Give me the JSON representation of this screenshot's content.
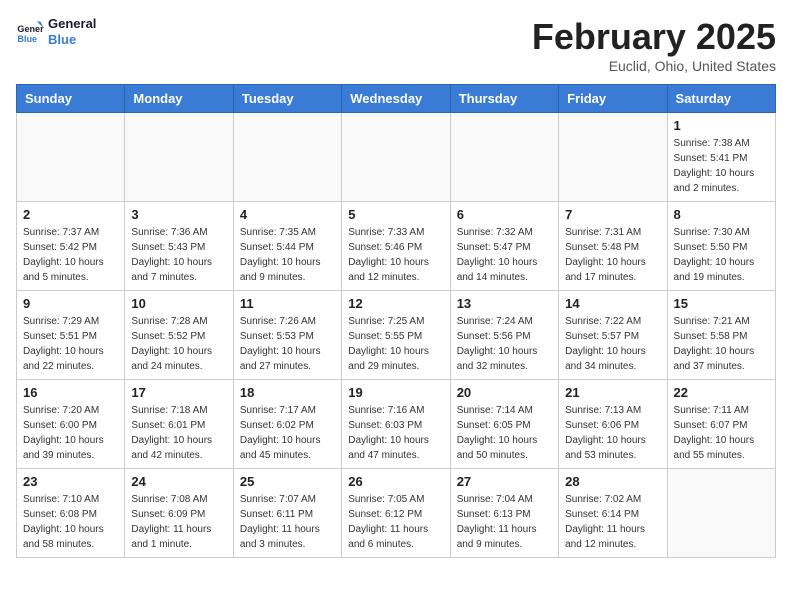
{
  "header": {
    "logo_general": "General",
    "logo_blue": "Blue",
    "title": "February 2025",
    "subtitle": "Euclid, Ohio, United States"
  },
  "days_of_week": [
    "Sunday",
    "Monday",
    "Tuesday",
    "Wednesday",
    "Thursday",
    "Friday",
    "Saturday"
  ],
  "weeks": [
    [
      {
        "day": "",
        "info": ""
      },
      {
        "day": "",
        "info": ""
      },
      {
        "day": "",
        "info": ""
      },
      {
        "day": "",
        "info": ""
      },
      {
        "day": "",
        "info": ""
      },
      {
        "day": "",
        "info": ""
      },
      {
        "day": "1",
        "info": "Sunrise: 7:38 AM\nSunset: 5:41 PM\nDaylight: 10 hours\nand 2 minutes."
      }
    ],
    [
      {
        "day": "2",
        "info": "Sunrise: 7:37 AM\nSunset: 5:42 PM\nDaylight: 10 hours\nand 5 minutes."
      },
      {
        "day": "3",
        "info": "Sunrise: 7:36 AM\nSunset: 5:43 PM\nDaylight: 10 hours\nand 7 minutes."
      },
      {
        "day": "4",
        "info": "Sunrise: 7:35 AM\nSunset: 5:44 PM\nDaylight: 10 hours\nand 9 minutes."
      },
      {
        "day": "5",
        "info": "Sunrise: 7:33 AM\nSunset: 5:46 PM\nDaylight: 10 hours\nand 12 minutes."
      },
      {
        "day": "6",
        "info": "Sunrise: 7:32 AM\nSunset: 5:47 PM\nDaylight: 10 hours\nand 14 minutes."
      },
      {
        "day": "7",
        "info": "Sunrise: 7:31 AM\nSunset: 5:48 PM\nDaylight: 10 hours\nand 17 minutes."
      },
      {
        "day": "8",
        "info": "Sunrise: 7:30 AM\nSunset: 5:50 PM\nDaylight: 10 hours\nand 19 minutes."
      }
    ],
    [
      {
        "day": "9",
        "info": "Sunrise: 7:29 AM\nSunset: 5:51 PM\nDaylight: 10 hours\nand 22 minutes."
      },
      {
        "day": "10",
        "info": "Sunrise: 7:28 AM\nSunset: 5:52 PM\nDaylight: 10 hours\nand 24 minutes."
      },
      {
        "day": "11",
        "info": "Sunrise: 7:26 AM\nSunset: 5:53 PM\nDaylight: 10 hours\nand 27 minutes."
      },
      {
        "day": "12",
        "info": "Sunrise: 7:25 AM\nSunset: 5:55 PM\nDaylight: 10 hours\nand 29 minutes."
      },
      {
        "day": "13",
        "info": "Sunrise: 7:24 AM\nSunset: 5:56 PM\nDaylight: 10 hours\nand 32 minutes."
      },
      {
        "day": "14",
        "info": "Sunrise: 7:22 AM\nSunset: 5:57 PM\nDaylight: 10 hours\nand 34 minutes."
      },
      {
        "day": "15",
        "info": "Sunrise: 7:21 AM\nSunset: 5:58 PM\nDaylight: 10 hours\nand 37 minutes."
      }
    ],
    [
      {
        "day": "16",
        "info": "Sunrise: 7:20 AM\nSunset: 6:00 PM\nDaylight: 10 hours\nand 39 minutes."
      },
      {
        "day": "17",
        "info": "Sunrise: 7:18 AM\nSunset: 6:01 PM\nDaylight: 10 hours\nand 42 minutes."
      },
      {
        "day": "18",
        "info": "Sunrise: 7:17 AM\nSunset: 6:02 PM\nDaylight: 10 hours\nand 45 minutes."
      },
      {
        "day": "19",
        "info": "Sunrise: 7:16 AM\nSunset: 6:03 PM\nDaylight: 10 hours\nand 47 minutes."
      },
      {
        "day": "20",
        "info": "Sunrise: 7:14 AM\nSunset: 6:05 PM\nDaylight: 10 hours\nand 50 minutes."
      },
      {
        "day": "21",
        "info": "Sunrise: 7:13 AM\nSunset: 6:06 PM\nDaylight: 10 hours\nand 53 minutes."
      },
      {
        "day": "22",
        "info": "Sunrise: 7:11 AM\nSunset: 6:07 PM\nDaylight: 10 hours\nand 55 minutes."
      }
    ],
    [
      {
        "day": "23",
        "info": "Sunrise: 7:10 AM\nSunset: 6:08 PM\nDaylight: 10 hours\nand 58 minutes."
      },
      {
        "day": "24",
        "info": "Sunrise: 7:08 AM\nSunset: 6:09 PM\nDaylight: 11 hours\nand 1 minute."
      },
      {
        "day": "25",
        "info": "Sunrise: 7:07 AM\nSunset: 6:11 PM\nDaylight: 11 hours\nand 3 minutes."
      },
      {
        "day": "26",
        "info": "Sunrise: 7:05 AM\nSunset: 6:12 PM\nDaylight: 11 hours\nand 6 minutes."
      },
      {
        "day": "27",
        "info": "Sunrise: 7:04 AM\nSunset: 6:13 PM\nDaylight: 11 hours\nand 9 minutes."
      },
      {
        "day": "28",
        "info": "Sunrise: 7:02 AM\nSunset: 6:14 PM\nDaylight: 11 hours\nand 12 minutes."
      },
      {
        "day": "",
        "info": ""
      }
    ]
  ]
}
